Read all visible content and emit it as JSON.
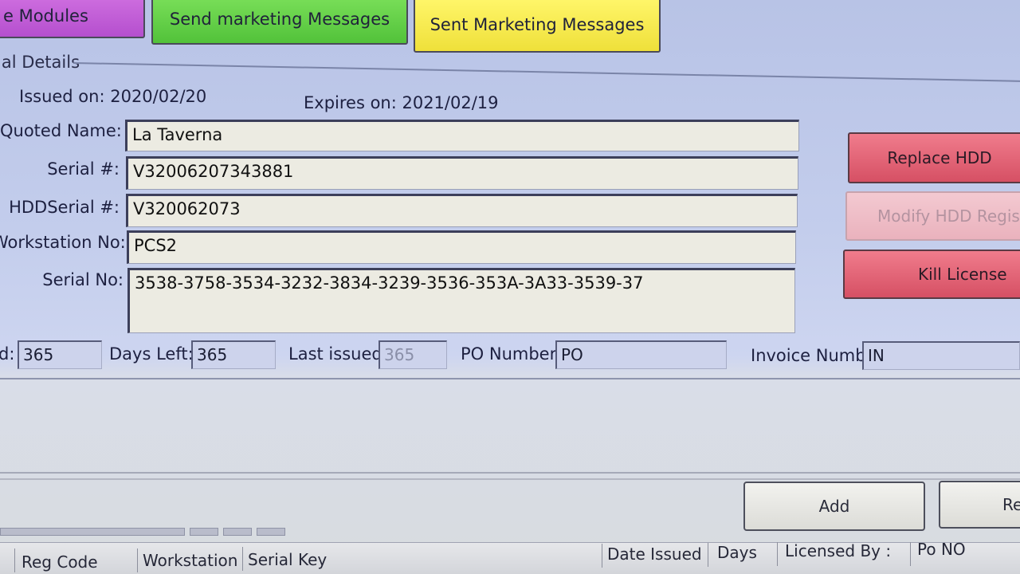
{
  "topbar": {
    "modules_label": "e Modules",
    "send_label": "Send marketing Messages",
    "sent_label": "Sent Marketing Messages"
  },
  "group": {
    "title": "ial Details"
  },
  "dates": {
    "issued": "Issued on: 2020/02/20",
    "expires": "Expires on: 2021/02/19"
  },
  "form": {
    "quoted_name_label": "Quoted Name:",
    "quoted_name_value": "La Taverna",
    "serial_label": "Serial #:",
    "serial_value": "V32006207343881",
    "hdd_serial_label": "HDDSerial #:",
    "hdd_serial_value": "V320062073",
    "workstation_label": "Workstation No:",
    "workstation_value": "PCS2",
    "serial_no_label": "Serial No:",
    "serial_no_value": "3538-3758-3534-3232-3834-3239-3536-353A-3A33-3539-37"
  },
  "actions": {
    "replace_hdd": "Replace HDD",
    "modify_hdd": "Modify HDD Registrati",
    "kill_license": "Kill License"
  },
  "counts": {
    "days_label": "d:",
    "days_value": "365",
    "days_left_label": "Days Left:",
    "days_left_value": "365",
    "last_issued_label": "Last issued:",
    "last_issued_value": "365",
    "po_label": "PO Number:",
    "po_value": "PO",
    "invoice_label": "Invoice Number:",
    "invoice_value": "IN"
  },
  "bottom_buttons": {
    "add": "Add",
    "re": "Re"
  },
  "table": {
    "columns": [
      "Reg Code",
      "Workstation",
      "Serial Key",
      "Date Issued",
      "Days",
      "Licensed By :",
      "Po NO"
    ]
  },
  "colors": {
    "modules": "#c35fd8",
    "send": "#66d04a",
    "sent": "#f5ea4a",
    "red_button": "#e0607a"
  }
}
